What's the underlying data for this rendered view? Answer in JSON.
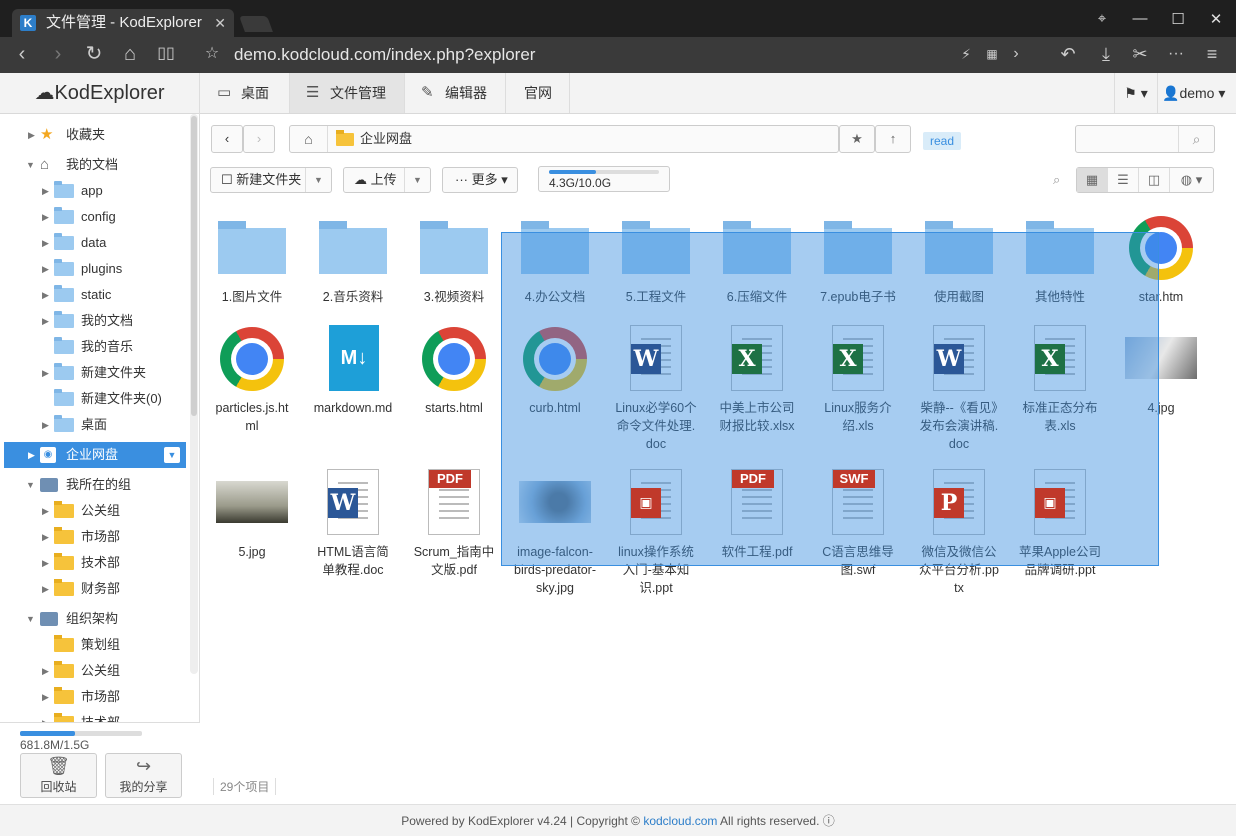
{
  "browser": {
    "tab_title": "文件管理 - KodExplorer",
    "tab_logo": "K",
    "url": "demo.kodcloud.com/index.php?explorer"
  },
  "header": {
    "brand": "KodExplorer",
    "nav": [
      {
        "label": "桌面",
        "icon": "monitor-icon"
      },
      {
        "label": "文件管理",
        "icon": "list-icon"
      },
      {
        "label": "编辑器",
        "icon": "edit-icon"
      },
      {
        "label": "官网",
        "icon": ""
      }
    ],
    "user": "demo"
  },
  "sidebar": {
    "favorites": "收藏夹",
    "my_docs": "我的文档",
    "doc_folders": [
      "app",
      "config",
      "data",
      "plugins",
      "static",
      "我的文档",
      "我的音乐",
      "新建文件夹",
      "新建文件夹(0)",
      "桌面"
    ],
    "enterprise": "企业网盘",
    "my_groups": "我所在的组",
    "groups": [
      "公关组",
      "市场部",
      "技术部",
      "财务部"
    ],
    "org": "组织架构",
    "org_items": [
      "策划组",
      "公关组",
      "市场部",
      "技术部"
    ],
    "quota_text": "681.8M/1.5G",
    "quota_fraction": 0.45,
    "recycle": "回收站",
    "share": "我的分享"
  },
  "toolbar": {
    "crumb": "企业网盘",
    "read_badge": "read",
    "new_folder": "新建文件夹",
    "upload": "上传",
    "more": "更多",
    "disk_text": "4.3G/10.0G",
    "disk_fraction": 0.43
  },
  "files": [
    {
      "name": "1.图片文件",
      "type": "folder"
    },
    {
      "name": "2.音乐资料",
      "type": "folder"
    },
    {
      "name": "3.视频资料",
      "type": "folder"
    },
    {
      "name": "4.办公文档",
      "type": "folder"
    },
    {
      "name": "5.工程文件",
      "type": "folder"
    },
    {
      "name": "6.压缩文件",
      "type": "folder"
    },
    {
      "name": "7.epub电子书",
      "type": "folder"
    },
    {
      "name": "使用截图",
      "type": "folder"
    },
    {
      "name": "其他特性",
      "type": "folder"
    },
    {
      "name": "star.htm",
      "type": "html"
    },
    {
      "name": "particles.js.html",
      "type": "html"
    },
    {
      "name": "markdown.md",
      "type": "md"
    },
    {
      "name": "starts.html",
      "type": "html"
    },
    {
      "name": "curb.html",
      "type": "html"
    },
    {
      "name": "Linux必学60个命令文件处理.doc",
      "type": "doc"
    },
    {
      "name": "中美上市公司财报比较.xlsx",
      "type": "xls"
    },
    {
      "name": "Linux服务介绍.xls",
      "type": "xls"
    },
    {
      "name": "柴静--《看见》发布会演讲稿.doc",
      "type": "doc"
    },
    {
      "name": "标准正态分布表.xls",
      "type": "xls"
    },
    {
      "name": "4.jpg",
      "type": "cat"
    },
    {
      "name": "5.jpg",
      "type": "sky"
    },
    {
      "name": "HTML语言简单教程.doc",
      "type": "doc"
    },
    {
      "name": "Scrum_指南中文版.pdf",
      "type": "pdf"
    },
    {
      "name": "image-falcon-birds-predator-sky.jpg",
      "type": "falcon"
    },
    {
      "name": "linux操作系统入门-基本知识.ppt",
      "type": "ppt"
    },
    {
      "name": "软件工程.pdf",
      "type": "pdf"
    },
    {
      "name": "C语言思维导图.swf",
      "type": "swf"
    },
    {
      "name": "微信及微信公众平台分析.pptx",
      "type": "pptx"
    },
    {
      "name": "苹果Apple公司品牌调研.ppt",
      "type": "ppt"
    }
  ],
  "colors": {
    "accent": "#3a8fe0",
    "word": "#2b5797",
    "excel": "#1e7145",
    "ppt": "#c0392b",
    "pdf": "#c0392b",
    "swf": "#c0392b"
  },
  "status": "29个项目",
  "footer": {
    "text1": "Powered by KodExplorer v4.24 | Copyright © ",
    "link": "kodcloud.com",
    "text2": " All rights reserved."
  }
}
